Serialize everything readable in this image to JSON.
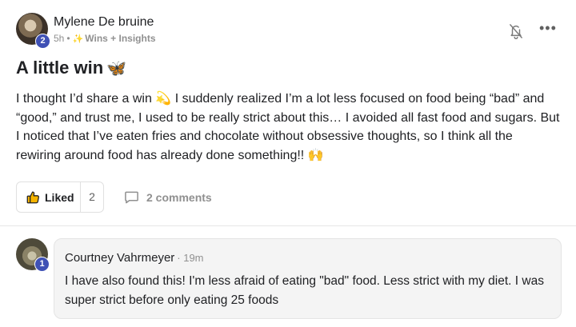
{
  "post": {
    "author": "Mylene De bruine",
    "author_level": "2",
    "time": "5h",
    "separator": "•",
    "category_icon": "sparkle-icon",
    "category": "Wins + Insights",
    "title": "A little win",
    "title_emoji": "🦋",
    "body": "I thought I’d share a win 💫 I suddenly realized I’m a lot less focused on food being “bad” and “good,” and trust me, I used to be really strict about this… I avoided all fast food and sugars. But I noticed that I’ve eaten fries and chocolate without obsessive thoughts, so I think all the rewiring around food has already done something!! 🙌"
  },
  "actions": {
    "like_label": "Liked",
    "like_count": "2",
    "comments_label": "2 comments"
  },
  "comment": {
    "author": "Courtney Vahrmeyer",
    "author_level": "1",
    "time": "· 19m",
    "text": "I have also found this! I'm less afraid of eating \"bad\" food. Less strict with my diet. I was super strict before only eating 25 foods"
  },
  "colors": {
    "badge": "#3f51b5",
    "muted": "#909090",
    "sparkle": "#f5b400",
    "bubble": "#f4f4f4"
  }
}
